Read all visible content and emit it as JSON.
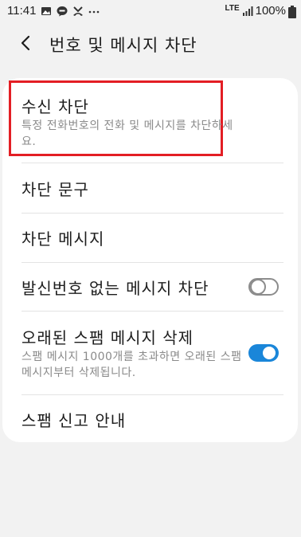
{
  "status_bar": {
    "time": "11:41",
    "network": "LTE",
    "battery": "100%",
    "left_icons": [
      "gallery-icon",
      "talk-icon",
      "missed-call-icon",
      "more-dots-icon"
    ],
    "right_icons": [
      "lte-icon",
      "signal-icon",
      "battery-icon"
    ]
  },
  "header": {
    "back_icon": "back-arrow-icon",
    "title": "번호 및 메시지 차단"
  },
  "settings": [
    {
      "title": "수신 차단",
      "subtitle": "특정 전화번호의 전화 및 메시지를 차단하세요.",
      "highlighted": true
    },
    {
      "title": "차단 문구"
    },
    {
      "title": "차단 메시지"
    },
    {
      "title": "발신번호 없는 메시지 차단",
      "toggle": "off"
    },
    {
      "title": "오래된 스팸 메시지 삭제",
      "subtitle": "스팸 메시지 1000개를 초과하면 오래된 스팸 메시지부터 삭제됩니다.",
      "toggle": "on"
    },
    {
      "title": "스팸 신고 안내"
    }
  ],
  "colors": {
    "background": "#f2f2f2",
    "card": "#ffffff",
    "highlight_border": "#e31e24",
    "toggle_on": "#1a86d9",
    "toggle_off": "#8c8c8c",
    "subtitle": "#8a8a8a"
  }
}
